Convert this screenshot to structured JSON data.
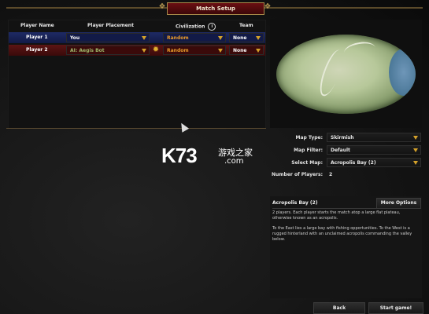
{
  "window": {
    "title": "Match Setup"
  },
  "table": {
    "headers": {
      "name": "Player Name",
      "placement": "Player Placement",
      "civ": "Civilization",
      "team": "Team"
    },
    "rows": [
      {
        "name": "Player 1",
        "placement": "You",
        "civ": "Random",
        "team": "None",
        "color": "#1e2a64"
      },
      {
        "name": "Player 2",
        "placement": "AI: Aegis Bot",
        "civ": "Random",
        "team": "None",
        "color": "#5b1414"
      }
    ]
  },
  "settings": {
    "map_type_label": "Map Type:",
    "map_type_value": "Skirmish",
    "map_filter_label": "Map Filter:",
    "map_filter_value": "Default",
    "select_map_label": "Select Map:",
    "select_map_value": "Acropolis Bay (2)",
    "num_players_label": "Number of Players:",
    "num_players_value": "2"
  },
  "description": {
    "title": "Acropolis Bay (2)",
    "more_options": "More Options",
    "para1": "2 players. Each player starts the match atop a large flat plateau, otherwise known as an acropolis.",
    "para2": "To the East lies a large bay with fishing opportunities. To the West is a rugged hinterland with an unclaimed acropolis commanding the valley below."
  },
  "buttons": {
    "back": "Back",
    "start": "Start game!"
  },
  "watermark": {
    "logo": "K73",
    "cn": "游戏之家",
    "com": ".com"
  },
  "colors": {
    "accent_gold": "#d4a12a",
    "title_red": "#6b0f12",
    "player1": "#1e2a64",
    "player2": "#5b1414"
  }
}
